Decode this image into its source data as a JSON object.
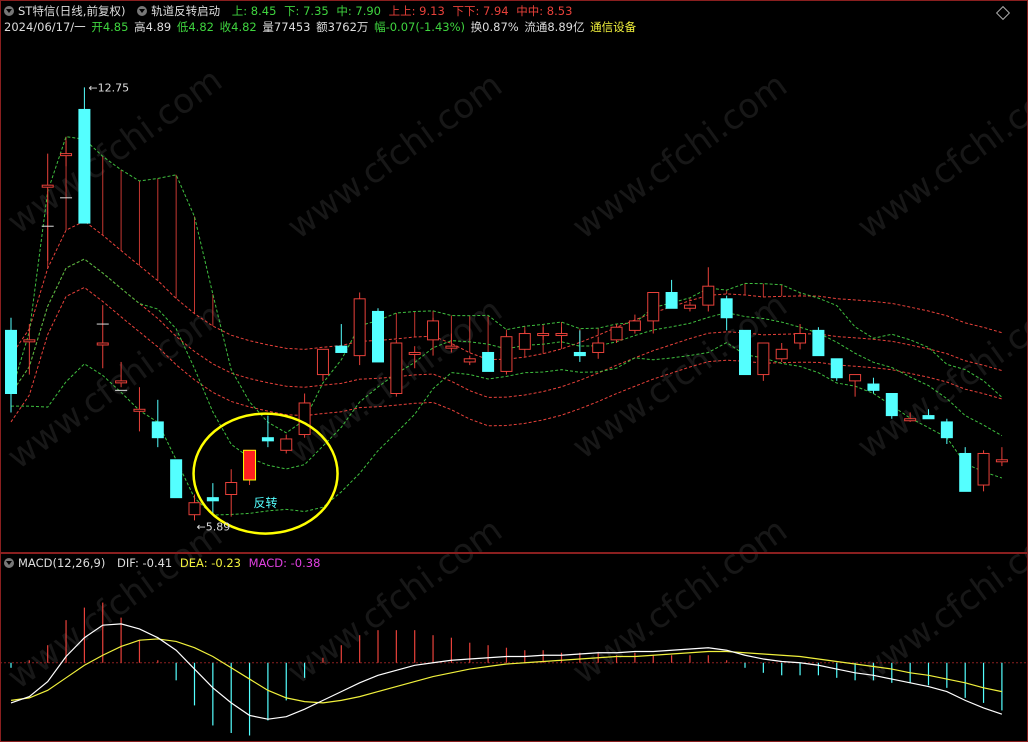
{
  "header": {
    "security_name": "ST特信(日线,前复权)",
    "indicator_name": "轨道反转启动",
    "up": "上: 8.45",
    "down": "下: 7.35",
    "mid": "中: 7.90",
    "upup": "上上: 9.13",
    "downdown": "下下: 7.94",
    "midmid": "中中: 8.53",
    "date": "2024/06/17/一",
    "open": "开4.85",
    "high": "高4.89",
    "low": "低4.82",
    "close": "收4.82",
    "volume": "量77453",
    "amount": "额3762万",
    "change": "幅-0.07(-1.43%)",
    "turnover": "换0.87%",
    "float": "流通8.89亿",
    "sector": "通信设备"
  },
  "macd_header": {
    "name": "MACD(12,26,9)",
    "dif": "DIF: -0.41",
    "dea": "DEA: -0.23",
    "macd": "MACD: -0.38"
  },
  "annotations": {
    "high_label": "12.75",
    "low_label": "5.89",
    "signal_label": "反转"
  },
  "watermark": "www.cfchi.com",
  "colors": {
    "background": "#000000",
    "up_candle": "#e8413a",
    "down_candle": "#54ffff",
    "upper_band": "#e8413a",
    "lower_band": "#3fbf3f",
    "dif_line": "#ffffff",
    "dea_line": "#f0f03c",
    "highlight": "#ffff00",
    "signal_candle": "#ff2020"
  },
  "chart_data": [
    {
      "type": "candlestick",
      "title": "",
      "ylim": [
        5.5,
        13.5
      ],
      "candles": [
        {
          "o": 8.9,
          "h": 9.1,
          "l": 7.6,
          "c": 7.9
        },
        {
          "o": 8.75,
          "h": 9.0,
          "l": 8.2,
          "c": 8.75
        },
        {
          "o": 11.2,
          "h": 11.7,
          "l": 10.0,
          "c": 11.2
        },
        {
          "o": 11.7,
          "h": 11.9,
          "l": 11.5,
          "c": 11.7
        },
        {
          "o": 12.4,
          "h": 12.75,
          "l": 10.6,
          "c": 10.6
        },
        {
          "o": 8.7,
          "h": 9.3,
          "l": 8.3,
          "c": 8.7
        },
        {
          "o": 8.1,
          "h": 8.4,
          "l": 8.0,
          "c": 8.1
        },
        {
          "o": 7.65,
          "h": 8.0,
          "l": 7.3,
          "c": 7.65
        },
        {
          "o": 7.45,
          "h": 7.8,
          "l": 7.05,
          "c": 7.2
        },
        {
          "o": 6.85,
          "h": 6.85,
          "l": 6.25,
          "c": 6.25
        },
        {
          "o": 5.98,
          "h": 6.3,
          "l": 5.89,
          "c": 6.17
        },
        {
          "o": 6.25,
          "h": 6.48,
          "l": 6.0,
          "c": 6.2
        },
        {
          "o": 6.3,
          "h": 6.7,
          "l": 5.95,
          "c": 6.49
        },
        {
          "o": 6.53,
          "h": 7.0,
          "l": 6.45,
          "c": 7.0
        },
        {
          "o": 7.2,
          "h": 7.55,
          "l": 7.05,
          "c": 7.15
        },
        {
          "o": 7.0,
          "h": 7.25,
          "l": 6.95,
          "c": 7.18
        },
        {
          "o": 7.25,
          "h": 7.9,
          "l": 7.2,
          "c": 7.75
        },
        {
          "o": 8.2,
          "h": 8.6,
          "l": 8.1,
          "c": 8.6
        },
        {
          "o": 8.65,
          "h": 9.0,
          "l": 8.55,
          "c": 8.55
        },
        {
          "o": 8.5,
          "h": 9.5,
          "l": 8.35,
          "c": 9.4
        },
        {
          "o": 9.2,
          "h": 9.25,
          "l": 8.4,
          "c": 8.4
        },
        {
          "o": 7.9,
          "h": 8.75,
          "l": 7.85,
          "c": 8.7
        },
        {
          "o": 8.55,
          "h": 8.65,
          "l": 8.3,
          "c": 8.55
        },
        {
          "o": 8.75,
          "h": 9.1,
          "l": 8.5,
          "c": 9.05
        },
        {
          "o": 8.65,
          "h": 8.85,
          "l": 8.55,
          "c": 8.65
        },
        {
          "o": 8.4,
          "h": 8.5,
          "l": 8.35,
          "c": 8.45
        },
        {
          "o": 8.55,
          "h": 8.55,
          "l": 8.25,
          "c": 8.25
        },
        {
          "o": 8.25,
          "h": 8.85,
          "l": 8.2,
          "c": 8.8
        },
        {
          "o": 8.6,
          "h": 8.9,
          "l": 8.6,
          "c": 8.85
        },
        {
          "o": 8.85,
          "h": 8.95,
          "l": 8.75,
          "c": 8.85
        },
        {
          "o": 8.85,
          "h": 8.95,
          "l": 8.7,
          "c": 8.85
        },
        {
          "o": 8.55,
          "h": 8.9,
          "l": 8.4,
          "c": 8.5
        },
        {
          "o": 8.55,
          "h": 8.8,
          "l": 8.45,
          "c": 8.7
        },
        {
          "o": 8.75,
          "h": 9.0,
          "l": 8.7,
          "c": 8.95
        },
        {
          "o": 8.9,
          "h": 9.15,
          "l": 8.85,
          "c": 9.05
        },
        {
          "o": 9.05,
          "h": 9.45,
          "l": 8.85,
          "c": 9.5
        },
        {
          "o": 9.5,
          "h": 9.7,
          "l": 9.25,
          "c": 9.25
        },
        {
          "o": 9.25,
          "h": 9.35,
          "l": 9.2,
          "c": 9.3
        },
        {
          "o": 9.3,
          "h": 9.9,
          "l": 9.2,
          "c": 9.6
        },
        {
          "o": 9.4,
          "h": 9.45,
          "l": 8.9,
          "c": 9.1
        },
        {
          "o": 8.9,
          "h": 8.9,
          "l": 8.2,
          "c": 8.2
        },
        {
          "o": 8.2,
          "h": 8.65,
          "l": 8.1,
          "c": 8.7
        },
        {
          "o": 8.45,
          "h": 8.7,
          "l": 8.4,
          "c": 8.6
        },
        {
          "o": 8.7,
          "h": 9.0,
          "l": 8.6,
          "c": 8.85
        },
        {
          "o": 8.9,
          "h": 8.95,
          "l": 8.5,
          "c": 8.5
        },
        {
          "o": 8.45,
          "h": 8.45,
          "l": 8.1,
          "c": 8.15
        },
        {
          "o": 8.1,
          "h": 8.2,
          "l": 7.85,
          "c": 8.2
        },
        {
          "o": 8.05,
          "h": 8.15,
          "l": 7.9,
          "c": 7.95
        },
        {
          "o": 7.9,
          "h": 7.9,
          "l": 7.5,
          "c": 7.55
        },
        {
          "o": 7.5,
          "h": 7.6,
          "l": 7.45,
          "c": 7.5
        },
        {
          "o": 7.55,
          "h": 7.65,
          "l": 7.5,
          "c": 7.5
        },
        {
          "o": 7.45,
          "h": 7.5,
          "l": 7.1,
          "c": 7.2
        },
        {
          "o": 6.95,
          "h": 7.05,
          "l": 6.35,
          "c": 6.35
        },
        {
          "o": 6.45,
          "h": 7.0,
          "l": 6.35,
          "c": 6.95
        },
        {
          "o": 6.85,
          "h": 7.05,
          "l": 6.75,
          "c": 6.85
        }
      ]
    },
    {
      "type": "line",
      "title": "MACD(12,26,9)",
      "ylim": [
        -0.6,
        0.7
      ],
      "series": [
        {
          "name": "DIF",
          "values": [
            -0.32,
            -0.27,
            -0.15,
            0.05,
            0.2,
            0.3,
            0.31,
            0.27,
            0.2,
            0.1,
            -0.05,
            -0.2,
            -0.32,
            -0.42,
            -0.45,
            -0.43,
            -0.37,
            -0.3,
            -0.23,
            -0.16,
            -0.1,
            -0.06,
            -0.02,
            0.0,
            0.02,
            0.03,
            0.04,
            0.05,
            0.05,
            0.06,
            0.06,
            0.07,
            0.08,
            0.08,
            0.09,
            0.09,
            0.1,
            0.11,
            0.12,
            0.1,
            0.06,
            0.03,
            0.01,
            0.0,
            -0.02,
            -0.05,
            -0.08,
            -0.1,
            -0.13,
            -0.16,
            -0.19,
            -0.23,
            -0.3,
            -0.36,
            -0.41
          ]
        },
        {
          "name": "DEA",
          "values": [
            -0.3,
            -0.28,
            -0.22,
            -0.12,
            -0.02,
            0.06,
            0.13,
            0.18,
            0.19,
            0.17,
            0.12,
            0.05,
            -0.04,
            -0.13,
            -0.22,
            -0.28,
            -0.31,
            -0.32,
            -0.3,
            -0.27,
            -0.23,
            -0.19,
            -0.15,
            -0.11,
            -0.08,
            -0.05,
            -0.03,
            -0.01,
            0.0,
            0.01,
            0.02,
            0.03,
            0.04,
            0.05,
            0.05,
            0.06,
            0.07,
            0.08,
            0.09,
            0.09,
            0.08,
            0.07,
            0.06,
            0.05,
            0.03,
            0.01,
            -0.01,
            -0.03,
            -0.05,
            -0.08,
            -0.1,
            -0.13,
            -0.16,
            -0.2,
            -0.23
          ]
        },
        {
          "name": "MACD",
          "values": [
            -0.04,
            0.02,
            0.14,
            0.34,
            0.44,
            0.48,
            0.36,
            0.18,
            0.02,
            -0.14,
            -0.34,
            -0.5,
            -0.56,
            -0.58,
            -0.46,
            -0.3,
            -0.12,
            0.04,
            0.14,
            0.22,
            0.26,
            0.26,
            0.26,
            0.22,
            0.2,
            0.16,
            0.14,
            0.12,
            0.1,
            0.1,
            0.08,
            0.08,
            0.08,
            0.06,
            0.08,
            0.06,
            0.06,
            0.06,
            0.06,
            0.02,
            -0.04,
            -0.08,
            -0.1,
            -0.1,
            -0.1,
            -0.12,
            -0.14,
            -0.14,
            -0.16,
            -0.16,
            -0.18,
            -0.2,
            -0.28,
            -0.32,
            -0.38
          ]
        }
      ]
    }
  ]
}
